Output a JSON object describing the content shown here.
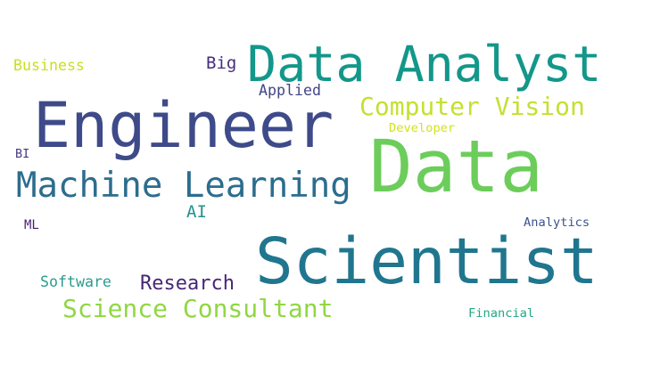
{
  "words": [
    {
      "text": "Data Analyst",
      "color": "#13978a"
    },
    {
      "text": "Engineer",
      "color": "#3e4a89"
    },
    {
      "text": "Data",
      "color": "#6ccd5a"
    },
    {
      "text": "Scientist",
      "color": "#20768e"
    },
    {
      "text": "Machine Learning",
      "color": "#2c6d8e"
    },
    {
      "text": "Computer Vision",
      "color": "#c4e032"
    },
    {
      "text": "Science Consultant",
      "color": "#90d743"
    },
    {
      "text": "Research",
      "color": "#482776"
    },
    {
      "text": "AI",
      "color": "#21918c"
    },
    {
      "text": "Big",
      "color": "#472d7b"
    },
    {
      "text": "Applied",
      "color": "#414487"
    },
    {
      "text": "Business",
      "color": "#c8e020"
    },
    {
      "text": "Developer",
      "color": "#d2e21b"
    },
    {
      "text": "BI",
      "color": "#443983"
    },
    {
      "text": "ML",
      "color": "#481f70"
    },
    {
      "text": "Analytics",
      "color": "#3b528b"
    },
    {
      "text": "Software",
      "color": "#2a9d8f"
    },
    {
      "text": "Financial",
      "color": "#22a884"
    }
  ]
}
